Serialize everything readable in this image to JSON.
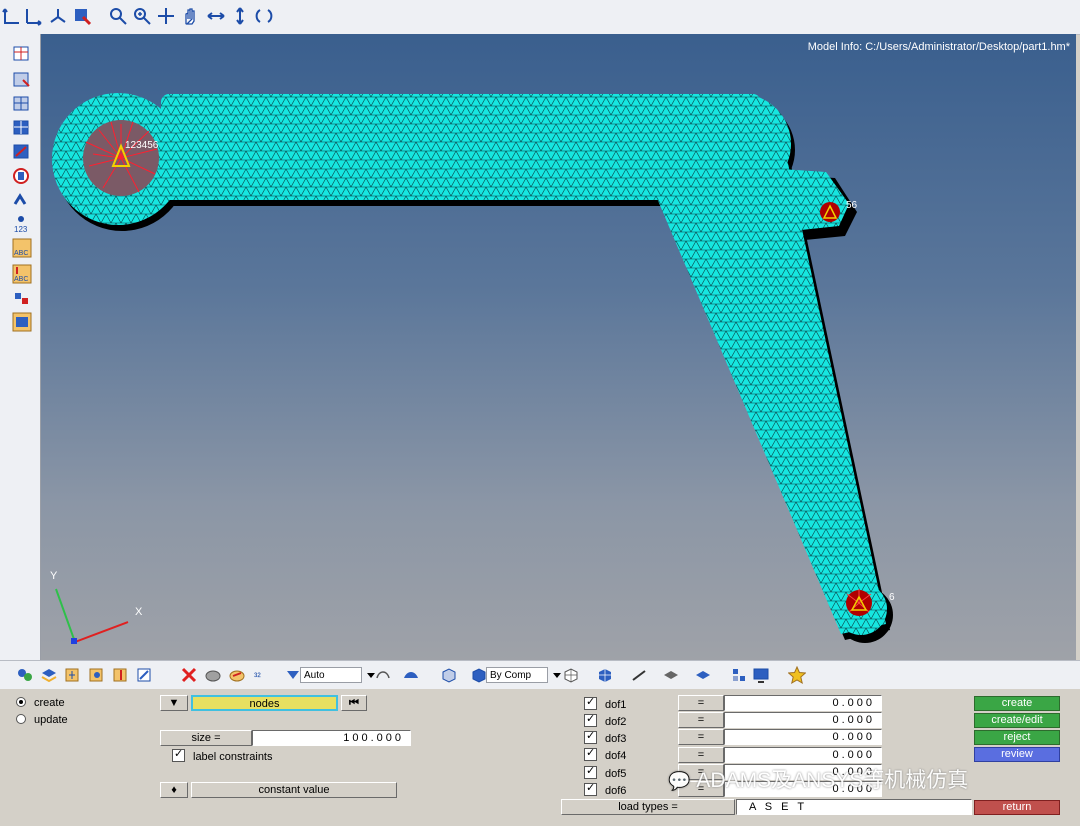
{
  "viewport": {
    "model_info": "Model Info: C:/Users/Administrator/Desktop/part1.hm*",
    "axis_x": "X",
    "axis_y": "Y",
    "dof_labels": [
      "123456",
      "56",
      "6"
    ]
  },
  "toolbar_row": {
    "auto_select": "Auto",
    "color_mode": "By Comp"
  },
  "panel": {
    "radios": [
      {
        "label": "create",
        "selected": true
      },
      {
        "label": "update",
        "selected": false
      }
    ],
    "entity_selector": "nodes",
    "size_label": "size =",
    "size_value": "100.000",
    "label_constraints": "label constraints",
    "constant_value": "constant value",
    "dofs": [
      {
        "label": "dof1",
        "eq": "=",
        "value": "0.000"
      },
      {
        "label": "dof2",
        "eq": "=",
        "value": "0.000"
      },
      {
        "label": "dof3",
        "eq": "=",
        "value": "0.000"
      },
      {
        "label": "dof4",
        "eq": "=",
        "value": "0.000"
      },
      {
        "label": "dof5",
        "eq": "=",
        "value": "0.000"
      },
      {
        "label": "dof6",
        "eq": "=",
        "value": "0.000"
      }
    ],
    "load_types_label": "load types =",
    "load_types_value": "A S E T",
    "actions": {
      "create": "create",
      "create_edit": "create/edit",
      "reject": "reject",
      "review": "review",
      "return": "return"
    }
  },
  "watermark": "ADAMS及ANSYS等机械仿真",
  "colors": {
    "mesh": "#16e6e0",
    "create_btn": "#3aa645",
    "review_btn": "#5a6ee0",
    "return_btn": "#c0504d"
  }
}
